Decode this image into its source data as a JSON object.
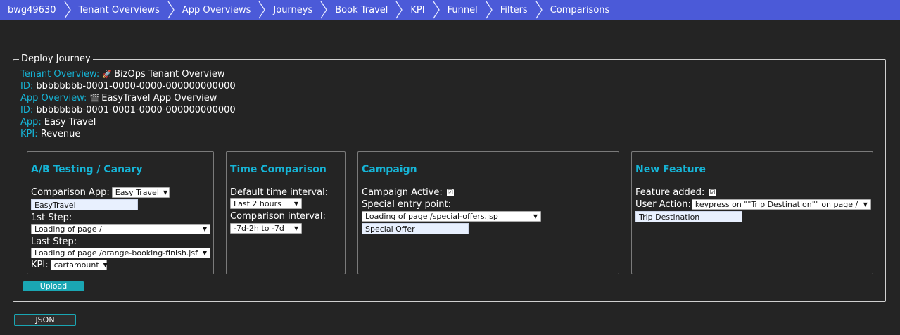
{
  "breadcrumb": [
    "bwg49630",
    "Tenant Overviews",
    "App Overviews",
    "Journeys",
    "Book Travel",
    "KPI",
    "Funnel",
    "Filters",
    "Comparisons"
  ],
  "deploy": {
    "legend": "Deploy Journey",
    "tenant_overview_label": "Tenant Overview:",
    "tenant_overview_icon": "🚀",
    "tenant_overview_value": "BizOps Tenant Overview",
    "tenant_id_label": "ID:",
    "tenant_id_value": "bbbbbbbb-0001-0000-0000-000000000000",
    "app_overview_label": "App Overview:",
    "app_overview_icon": "🎬",
    "app_overview_value": "EasyTravel App Overview",
    "app_id_label": "ID:",
    "app_id_value": "bbbbbbbb-0001-0001-0000-000000000000",
    "app_label": "App:",
    "app_value": "Easy Travel",
    "kpi_label": "KPI:",
    "kpi_value": "Revenue"
  },
  "ab": {
    "title": "A/B Testing / Canary",
    "comparison_app_label": "Comparison App:",
    "comparison_app_value": "Easy Travel",
    "comparison_app_input": "EasyTravel",
    "first_step_label": "1st Step:",
    "first_step_value": "Loading of page /",
    "last_step_label": "Last Step:",
    "last_step_value": "Loading of page /orange-booking-finish.jsf",
    "kpi_label": "KPI:",
    "kpi_value": "cartamount"
  },
  "time": {
    "title": "Time Comparison",
    "default_label": "Default time interval:",
    "default_value": "Last 2 hours",
    "comparison_label": "Comparison interval:",
    "comparison_value": "-7d-2h to -7d"
  },
  "campaign": {
    "title": "Campaign",
    "active_label": "Campaign Active:",
    "active_checked": true,
    "entry_label": "Special entry point:",
    "entry_value": "Loading of page /special-offers.jsp",
    "entry_input": "Special Offer"
  },
  "feature": {
    "title": "New Feature",
    "added_label": "Feature added:",
    "added_checked": true,
    "action_label": "User Action:",
    "action_value": "keypress on \"\"Trip Destination\"\" on page /",
    "action_input": "Trip Destination"
  },
  "buttons": {
    "upload": "Upload",
    "json": "JSON"
  },
  "icons": {
    "checkbox_mark": "☑",
    "select_arrow": "▼"
  },
  "colors": {
    "breadcrumb_bg": "#4b5ad8",
    "accent": "#16b4d6",
    "button": "#1aa6b3",
    "background": "#242424"
  }
}
